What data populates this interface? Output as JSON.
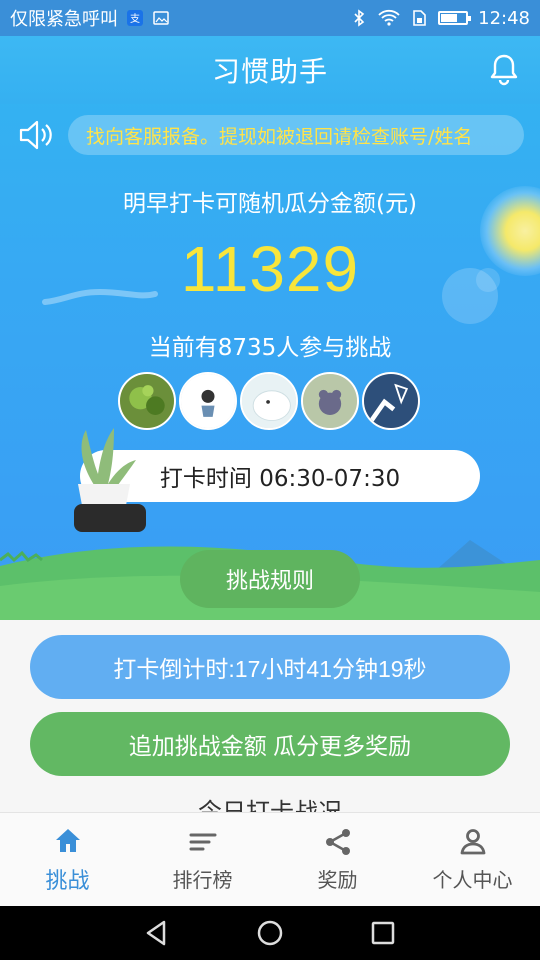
{
  "status_bar": {
    "carrier": "仅限紧急呼叫",
    "time": "12:48",
    "icons": [
      "alipay-icon",
      "image-icon",
      "bluetooth-icon",
      "wifi-icon",
      "sim-icon",
      "battery-icon"
    ]
  },
  "header": {
    "title": "习惯助手",
    "bell_icon": "bell-icon"
  },
  "notice": {
    "text": "找向客服报备。提现如被退回请检查账号/姓名"
  },
  "hero": {
    "pool_label": "明早打卡可随机瓜分金额(元)",
    "amount": "11329",
    "participants": "当前有8735人参与挑战",
    "checkin_time": "打卡时间 06:30-07:30",
    "rules_button": "挑战规则"
  },
  "actions": {
    "countdown": "打卡倒计时:17小时41分钟19秒",
    "add_challenge": "追加挑战金额 瓜分更多奖励"
  },
  "section": {
    "title": "今日打卡战况"
  },
  "tabs": [
    {
      "label": "挑战",
      "icon": "home-icon",
      "active": true
    },
    {
      "label": "排行榜",
      "icon": "list-icon",
      "active": false
    },
    {
      "label": "奖励",
      "icon": "share-icon",
      "active": false
    },
    {
      "label": "个人中心",
      "icon": "person-icon",
      "active": false
    }
  ],
  "colors": {
    "primary": "#3a8fd8",
    "hero_blue": "#36aef2",
    "amount_yellow": "#f8e53b",
    "notice_yellow": "#ffe34a",
    "green": "#62b863",
    "countdown_blue": "#61aef2"
  }
}
